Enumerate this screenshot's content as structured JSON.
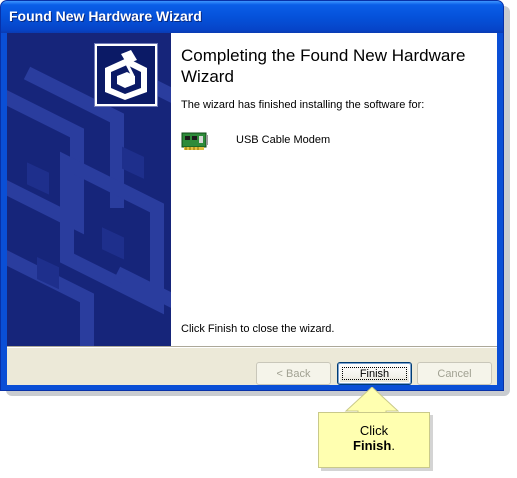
{
  "window": {
    "title": "Found New Hardware Wizard"
  },
  "wizard": {
    "heading": "Completing the Found New Hardware Wizard",
    "intro": "The wizard has finished installing the software for:",
    "device_name": "USB Cable Modem",
    "finish_note": "Click Finish to close the wizard."
  },
  "buttons": {
    "back_label": "< Back",
    "finish_label": "Finish",
    "cancel_label": "Cancel"
  },
  "callout": {
    "line1": "Click",
    "line2": "Finish",
    "line2_suffix": "."
  },
  "icons": {
    "wizard": "hardware-wizard-icon",
    "device": "network-card-icon"
  },
  "colors": {
    "titlebar": "#0552da",
    "left_panel": "#16257a",
    "callout_bg": "#ffffb0",
    "dialog_face": "#ece9d8"
  }
}
